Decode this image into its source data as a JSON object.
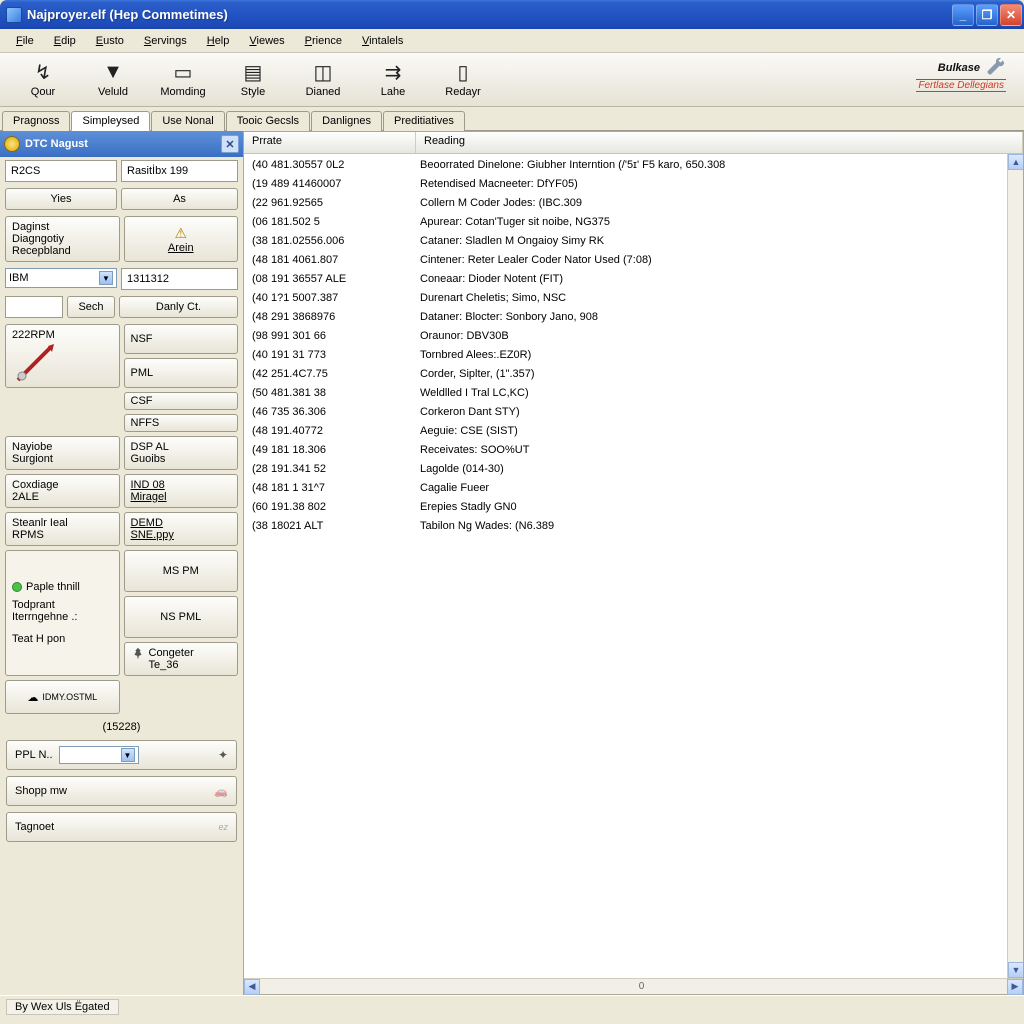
{
  "window": {
    "title": "Najproyer.elf (Hep Commetimes)"
  },
  "menu": [
    "File",
    "Edip",
    "Eusto",
    "Servings",
    "Help",
    "Viewes",
    "Prience",
    "Vintalels"
  ],
  "toolbar": [
    {
      "icon": "↯",
      "label": "Qour"
    },
    {
      "icon": "▼",
      "label": "Veluld"
    },
    {
      "icon": "▭",
      "label": "Momding"
    },
    {
      "icon": "▤",
      "label": "Style"
    },
    {
      "icon": "◫",
      "label": "Dianed"
    },
    {
      "icon": "⇉",
      "label": "Lahe"
    },
    {
      "icon": "▯",
      "label": "Redayr"
    }
  ],
  "brand": {
    "name": "Bulkase",
    "sub": "Fertlase Dellegians"
  },
  "tabs": [
    "Pragnoss",
    "Simpleysed",
    "Use Nonal",
    "Tooic Gecsls",
    "Danlignes",
    "Preditiatives"
  ],
  "tabs_active": 1,
  "panel": {
    "title": "DTC Nagust",
    "r2cs": "R2CS",
    "rasit": "Rasitİbx 199",
    "yies": "Yies",
    "as": "As",
    "daginst": "Daginst\nDiagngotiy\nRecepbland",
    "arein": "Arein",
    "ibm": "IBM",
    "num": "1311312",
    "sech": "Sech",
    "danly": "Danly Ct.",
    "rpm": "222RPM",
    "nsf": "NSF",
    "pml": "PML",
    "csf": "CSF",
    "nffs": "NFFS",
    "nayiobe": "Nayiobe\nSurgiont",
    "dspal": "DSP AL\nGuoibs",
    "coxdiage": "Coxdiage\n2ALE",
    "ind08": "IND 08\nMiragel",
    "steanlr": "Steanlr Ieal\nRPMS",
    "demd": "DEMD\nSNE.ppy",
    "paple": "Paple thnill",
    "todprant": "Todprant\nIterrngehne .:",
    "teat": "Teat H pon",
    "mspm": "MS PM",
    "nspml": "NS PML",
    "congeter": "Congeter\nTe_36",
    "idmy": "IDMY.OSTML",
    "paren_num": "(15228)",
    "ppl": "PPL N..",
    "shopp": "Shopp mw",
    "tagnoet": "Tagnoet"
  },
  "cols": {
    "c1": "Prrate",
    "c2": "Reading"
  },
  "rows": [
    {
      "p": "(40 481.30557 0L2",
      "r": "Beoorrated Dinelone: Giubher Interntion (/'5ɪ' F5 karo, 650.308"
    },
    {
      "p": "(19 489 41460007",
      "r": "Retendised Macneeter: DfYF05)"
    },
    {
      "p": "(22 961.92565",
      "r": "Collern M Coder Jodes: (IBC.309"
    },
    {
      "p": "(06 181.502 5",
      "r": "Apurear: Cotan'Tuger sit noibe, NG375"
    },
    {
      "p": "(38 181.02556.006",
      "r": "Cataner: Sladlen M Ongaioy Simy RK"
    },
    {
      "p": "(48 181 4061.807",
      "r": "Cintener: Reter Lealer Coder Nator Used (7:08)"
    },
    {
      "p": "(08 191 36557 ALE",
      "r": "Coneaar: Dioder Notent (FIT)"
    },
    {
      "p": "(40 1?1 5007.387",
      "r": "Durenart Cheletis; Simo, NSC"
    },
    {
      "p": "(48 291 3868976",
      "r": "Dataner: Blocter: Sonbory Jano, 908"
    },
    {
      "p": "(98 991 301 66",
      "r": "Oraunor: DBV30B"
    },
    {
      "p": "(40 191 31 773",
      "r": "Tornbred Alees:.EZ0R)"
    },
    {
      "p": "(42 251.4C7.75",
      "r": "Corder, Siplter, (1\".357)"
    },
    {
      "p": "(50 481.381 38",
      "r": "Weldlled I Tral LC,KC)"
    },
    {
      "p": "(46 735 36.306",
      "r": "Corkeron Dant STY)"
    },
    {
      "p": "(48 191.40772",
      "r": "Aeguie: CSE (SIST)"
    },
    {
      "p": "(49 181 18.306",
      "r": "Receivates: SOO%UT"
    },
    {
      "p": "(28 191.341 52",
      "r": "Lagolde (014-30)"
    },
    {
      "p": "(48 181 1 31^7",
      "r": "Cagalie Fueer"
    },
    {
      "p": "(60 191.38 802",
      "r": "Erepies Stadly GN0"
    },
    {
      "p": "(38 18021 ALT",
      "r": "Tabilon Ng Wades: (N6.389"
    }
  ],
  "hscroll_center": "0",
  "status": "By Wex Uls Ёgated"
}
